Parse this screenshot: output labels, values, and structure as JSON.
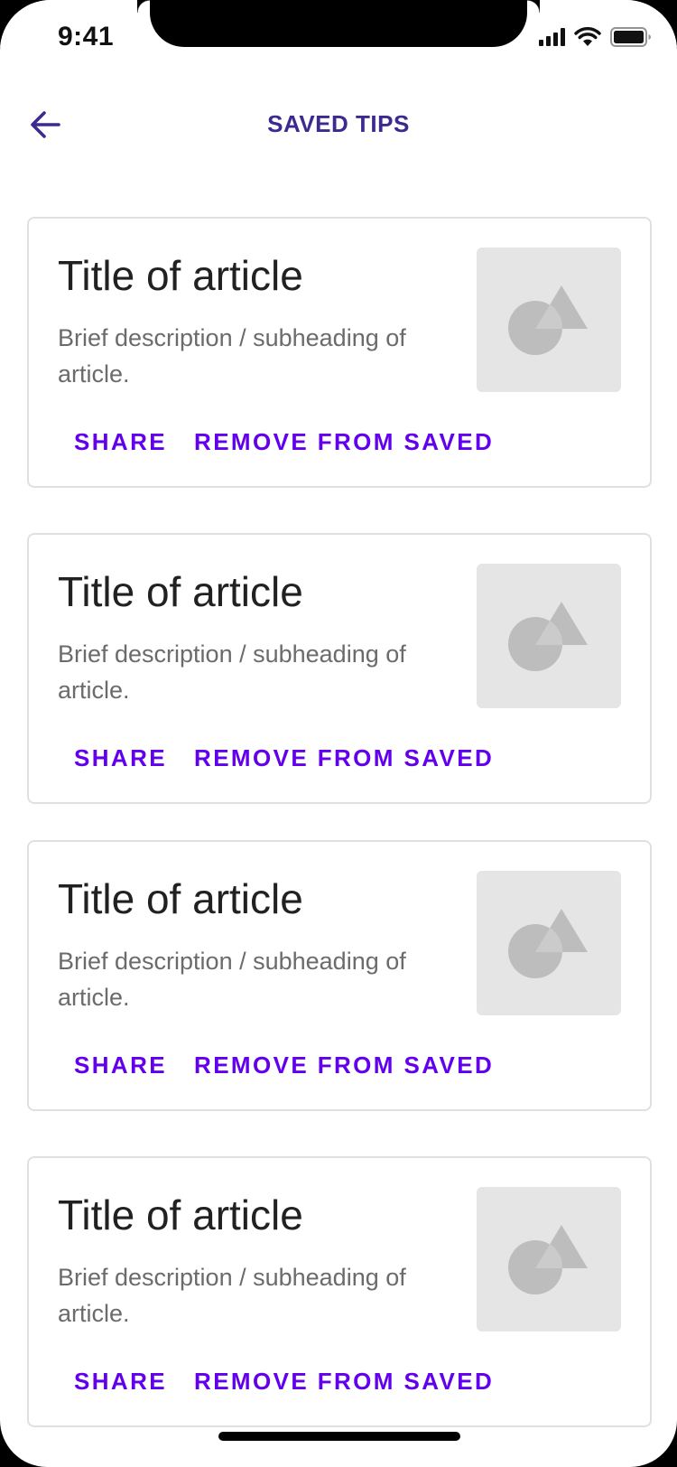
{
  "status_bar": {
    "time": "9:41"
  },
  "header": {
    "title": "SAVED TIPS",
    "back_icon": "arrow-left-icon"
  },
  "colors": {
    "accent": "#6200ee",
    "title": "#3c2a8e",
    "card_border": "#e0e0e0",
    "placeholder_bg": "#e5e5e5",
    "placeholder_shape": "#bdbdbd"
  },
  "cards": [
    {
      "title": "Title of article",
      "description": "Brief description / subheading of article.",
      "image_icon": "image-placeholder-icon",
      "share_label": "SHARE",
      "remove_label": "REMOVE FROM SAVED"
    },
    {
      "title": "Title of article",
      "description": "Brief description / subheading of article.",
      "image_icon": "image-placeholder-icon",
      "share_label": "SHARE",
      "remove_label": "REMOVE FROM SAVED"
    },
    {
      "title": "Title of article",
      "description": "Brief description / subheading of article.",
      "image_icon": "image-placeholder-icon",
      "share_label": "SHARE",
      "remove_label": "REMOVE FROM SAVED"
    },
    {
      "title": "Title of article",
      "description": "Brief description / subheading of article.",
      "image_icon": "image-placeholder-icon",
      "share_label": "SHARE",
      "remove_label": "REMOVE FROM SAVED"
    }
  ]
}
